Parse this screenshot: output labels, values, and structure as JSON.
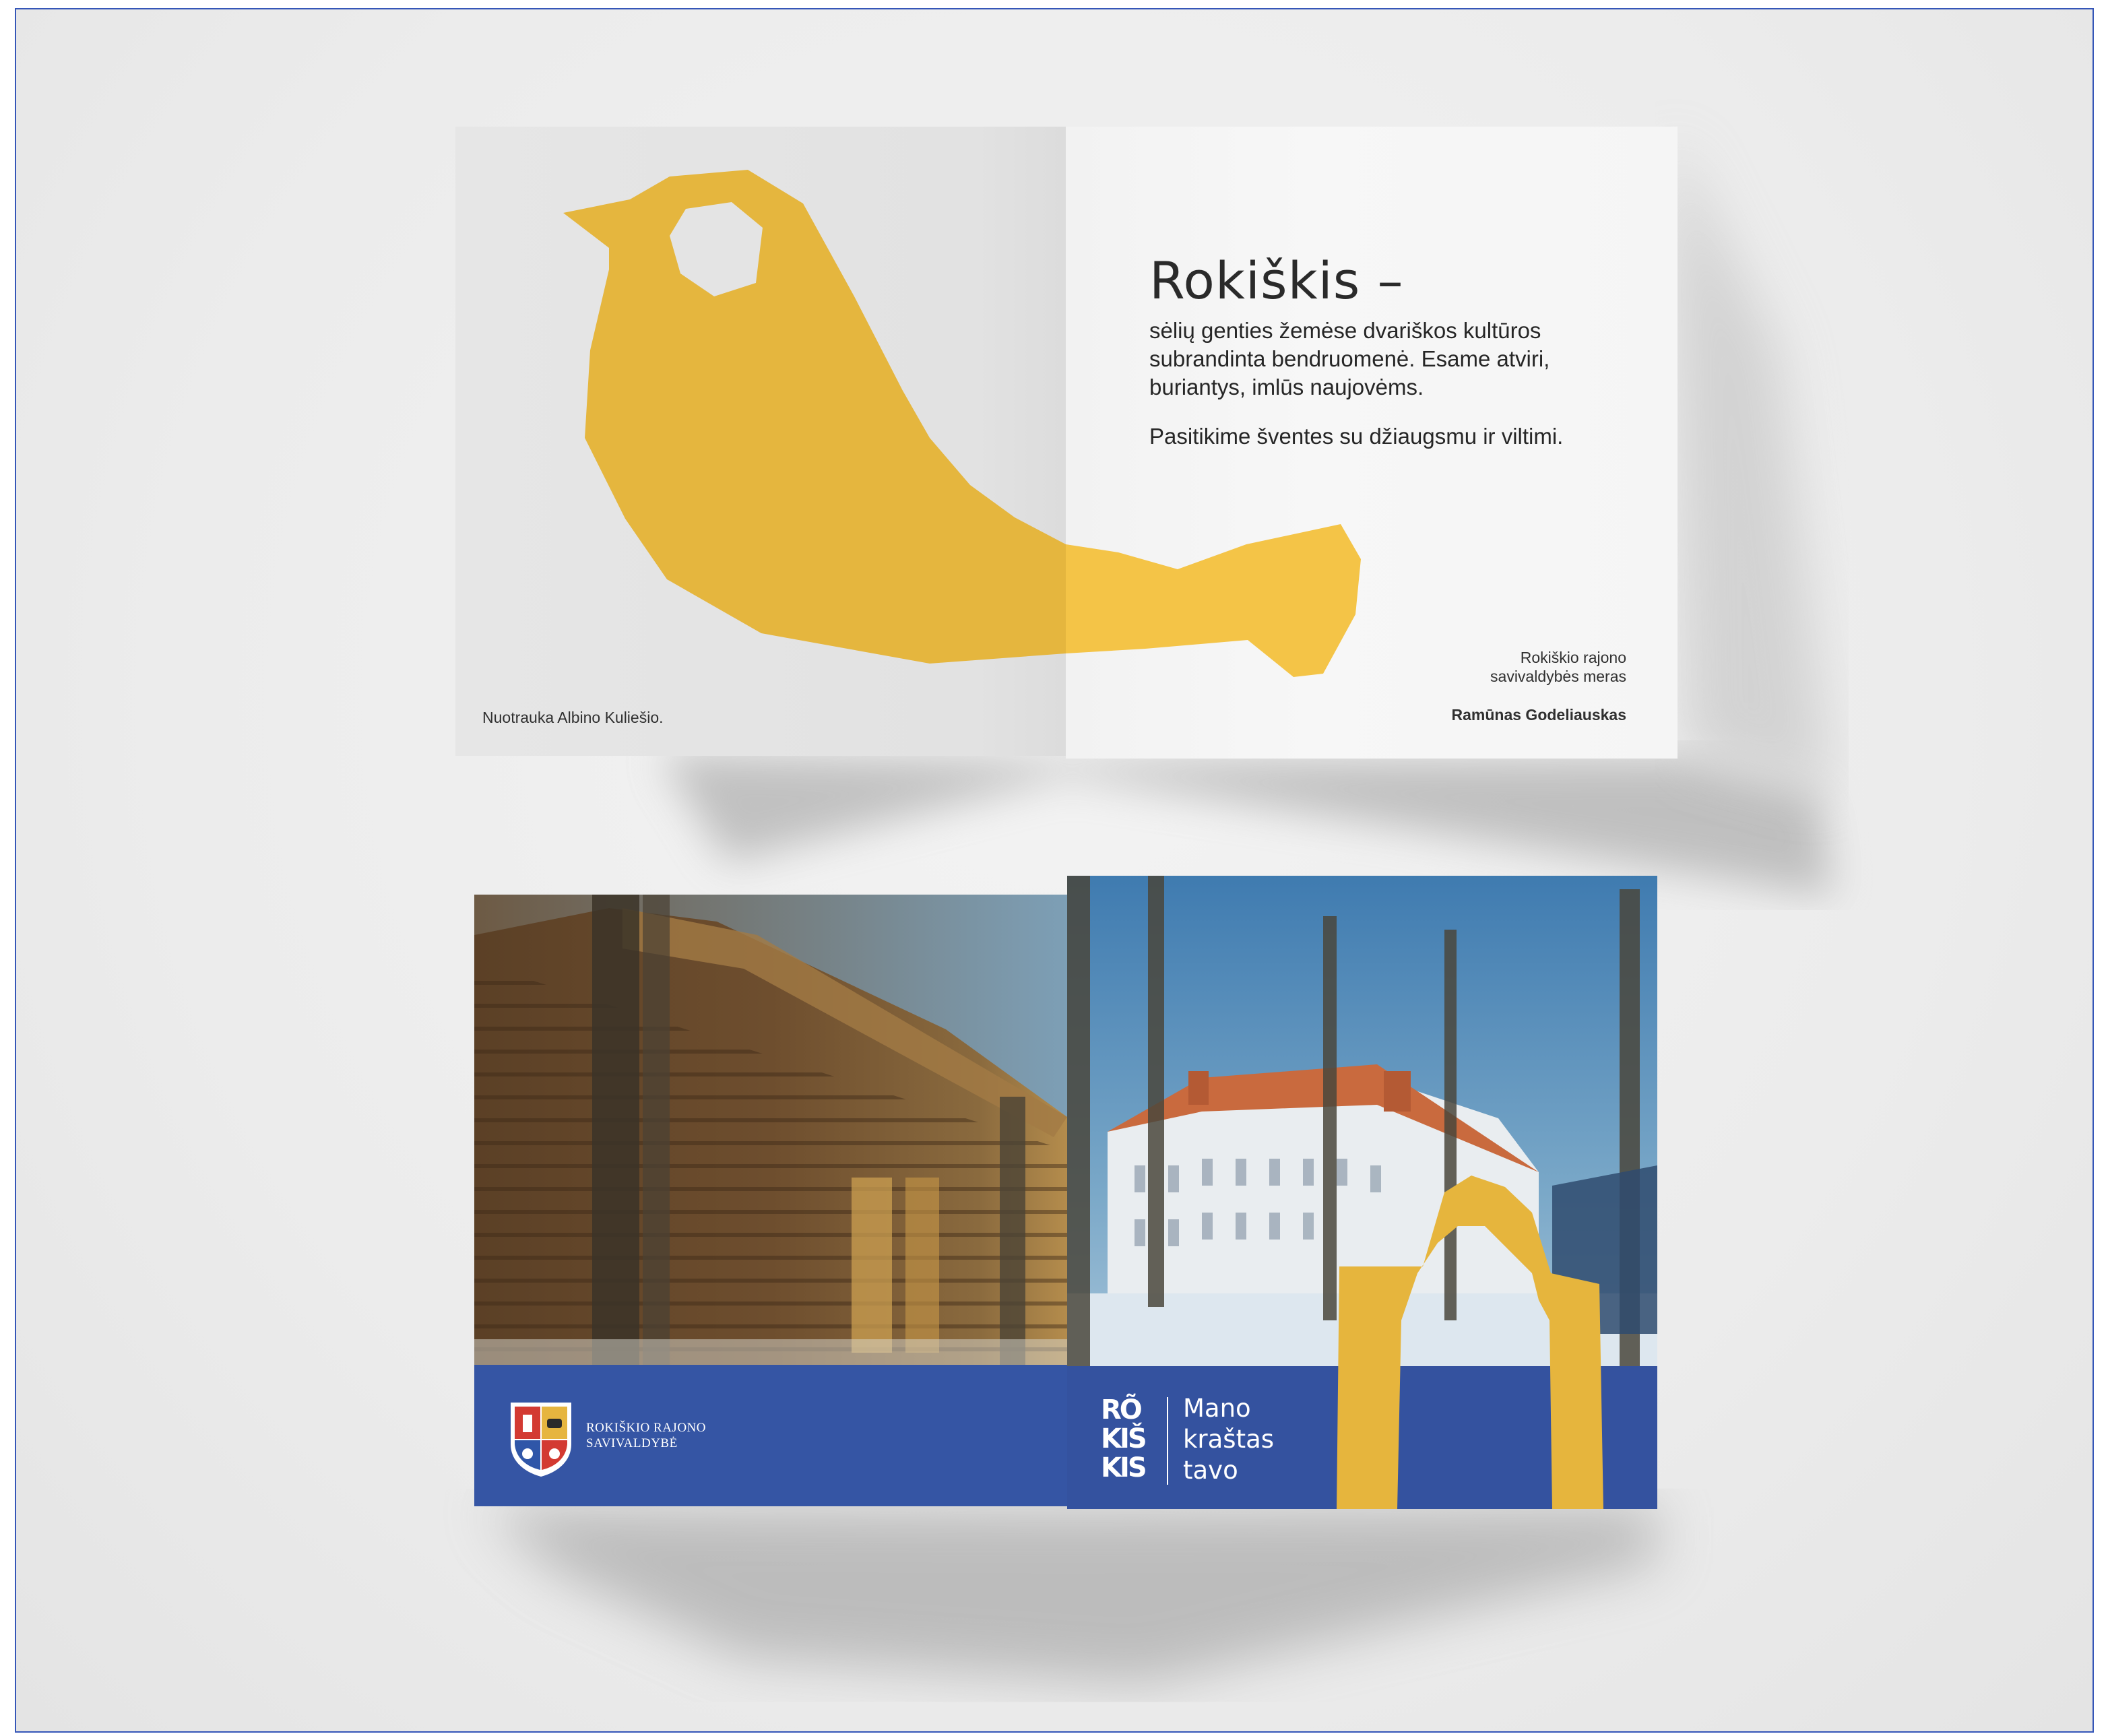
{
  "inside_spread": {
    "headline": "Rokiškis –",
    "body": "sėlių genties žemėse dvariškos kultūros subrandinta bendruomenė. Esame atviri, buriantys, imlūs naujovėms.",
    "greeting": "Pasitikime šventes su džiaugsmu ir viltimi.",
    "photo_credit": "Nuotrauka Albino Kuliešio.",
    "signature_title_line1": "Rokiškio rajono",
    "signature_title_line2": "savivaldybės meras",
    "signature_name": "Ramūnas Godeliauskas"
  },
  "cover": {
    "municipality_line1": "ROKIŠKIO RAJONO",
    "municipality_line2": "SAVIVALDYBĖ",
    "logo_letters": [
      "RÕ",
      "KIŠ",
      "KIS"
    ],
    "slogan_line1": "Mano",
    "slogan_line2": "kraštas",
    "slogan_line3": "tavo"
  },
  "colors": {
    "accent_yellow": "#e9b73e",
    "brand_blue": "#34529f",
    "background": "#ececec"
  }
}
